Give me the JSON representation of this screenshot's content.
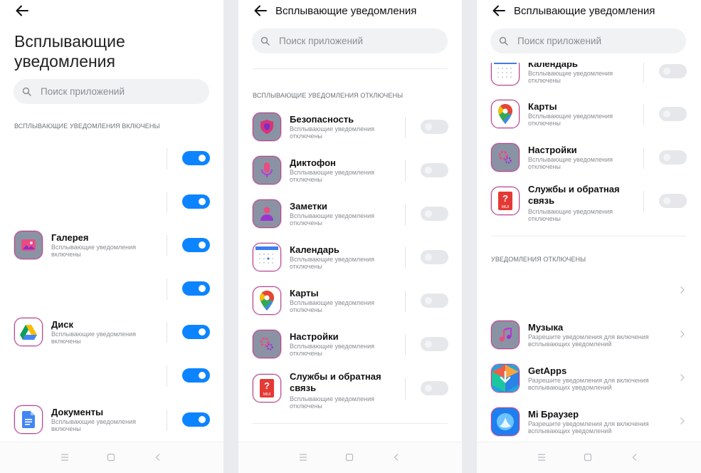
{
  "colors": {
    "accent": "#0d84ff",
    "toggle_off": "#e6e7ea"
  },
  "screen1": {
    "title_line1": "Всплывающие",
    "title_line2": "уведомления",
    "search_placeholder": "Поиск приложений",
    "section_enabled": "ВСПЛЫВАЮЩИЕ УВЕДОМЛЕНИЯ ВКЛЮЧЕНЫ",
    "rows": [
      {
        "name": "",
        "sub": "",
        "icon": "",
        "toggle": "on"
      },
      {
        "name": "",
        "sub": "",
        "icon": "",
        "toggle": "on"
      },
      {
        "name": "Галерея",
        "sub": "Всплывающие уведомления включены",
        "icon": "gallery-icon",
        "toggle": "on"
      },
      {
        "name": "",
        "sub": "",
        "icon": "",
        "toggle": "on"
      },
      {
        "name": "Диск",
        "sub": "Всплывающие уведомления включены",
        "icon": "drive-icon",
        "toggle": "on"
      },
      {
        "name": "",
        "sub": "",
        "icon": "",
        "toggle": "on"
      },
      {
        "name": "Документы",
        "sub": "Всплывающие уведомления включены",
        "icon": "docs-icon",
        "toggle": "on"
      }
    ]
  },
  "screen2": {
    "title": "Всплывающие уведомления",
    "search_placeholder": "Поиск приложений",
    "section_disabled": "ВСПЛЫВАЮЩИЕ УВЕДОМЛЕНИЯ ОТКЛЮЧЕНЫ",
    "rows": [
      {
        "name": "Безопасность",
        "sub": "Всплывающие уведомления отключены",
        "icon": "security-icon",
        "toggle": "off"
      },
      {
        "name": "Диктофон",
        "sub": "Всплывающие уведомления отключены",
        "icon": "recorder-icon",
        "toggle": "off"
      },
      {
        "name": "Заметки",
        "sub": "Всплывающие уведомления отключены",
        "icon": "notes-icon",
        "toggle": "off"
      },
      {
        "name": "Календарь",
        "sub": "Всплывающие уведомления отключены",
        "icon": "calendar-icon",
        "toggle": "off"
      },
      {
        "name": "Карты",
        "sub": "Всплывающие уведомления отключены",
        "icon": "maps-icon",
        "toggle": "off"
      },
      {
        "name": "Настройки",
        "sub": "Всплывающие уведомления отключены",
        "icon": "settings-icon",
        "toggle": "off"
      },
      {
        "name": "Службы и обратная связь",
        "sub": "Всплывающие уведомления отключены",
        "icon": "feedback-icon",
        "toggle": "off"
      }
    ]
  },
  "screen3": {
    "title": "Всплывающие уведомления",
    "search_placeholder": "Поиск приложений",
    "section_notif_off": "УВЕДОМЛЕНИЯ ОТКЛЮЧЕНЫ",
    "rows_popup": [
      {
        "name": "Календарь",
        "sub": "Всплывающие уведомления отключены",
        "icon": "calendar-icon",
        "toggle": "off"
      },
      {
        "name": "Карты",
        "sub": "Всплывающие уведомления отключены",
        "icon": "maps-icon",
        "toggle": "off"
      },
      {
        "name": "Настройки",
        "sub": "Всплывающие уведомления отключены",
        "icon": "settings-icon",
        "toggle": "off"
      },
      {
        "name": "Службы и обратная связь",
        "sub": "Всплывающие уведомления отключены",
        "icon": "feedback-icon",
        "toggle": "off"
      }
    ],
    "rows_notif": [
      {
        "name": "",
        "sub": "",
        "icon": ""
      },
      {
        "name": "Музыка",
        "sub": "Разрешите уведомления для включения всплывающих уведомлений",
        "icon": "music-icon"
      },
      {
        "name": "GetApps",
        "sub": "Разрешите уведомления для включения всплывающих уведомлений",
        "icon": "getapps-icon"
      },
      {
        "name": "Mi Браузер",
        "sub": "Разрешите уведомления для включения всплывающих уведомлений",
        "icon": "browser-icon"
      }
    ]
  }
}
